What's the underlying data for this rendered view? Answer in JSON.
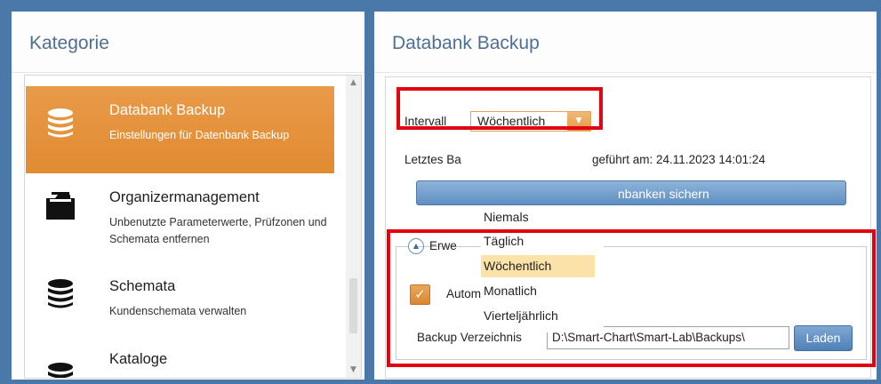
{
  "left_panel": {
    "title": "Kategorie",
    "items": [
      {
        "title": "Databank Backup",
        "description": "Einstellungen für Datenbank Backup",
        "icon": "database-icon",
        "selected": true
      },
      {
        "title": "Organizermanagement",
        "description": "Unbenutzte Parameterwerte, Prüfzonen und Schemata entfernen",
        "icon": "folder-icon",
        "selected": false
      },
      {
        "title": "Schemata",
        "description": "Kundenschemata verwalten",
        "icon": "database-icon",
        "selected": false
      },
      {
        "title": "Kataloge",
        "description": "",
        "icon": "database-icon",
        "selected": false
      }
    ]
  },
  "right_panel": {
    "title": "Databank Backup",
    "interval_label": "Intervall",
    "interval_value": "Wöchentlich",
    "last_backup_prefix": "Letztes Ba",
    "last_backup_suffix": "geführt am: 24.11.2023 14:01:24",
    "backup_button_label": "nbanken sichern",
    "group_label": "Erwe",
    "auto_backup_label": "Automatisches Backup",
    "auto_backup_checked": true,
    "directory_label": "Backup Verzeichnis",
    "directory_value": "D:\\Smart-Chart\\Smart-Lab\\Backups\\",
    "load_button_label": "Laden"
  },
  "dropdown": {
    "options": [
      "Niemals",
      "Täglich",
      "Wöchentlich",
      "Monatlich",
      "Vierteljährlich"
    ],
    "selected": "Wöchentlich"
  },
  "colors": {
    "accent_orange": "#e18b32",
    "title_blue": "#4e6f94",
    "highlight_red": "#e3000f",
    "frame_blue": "#4a78a8"
  }
}
